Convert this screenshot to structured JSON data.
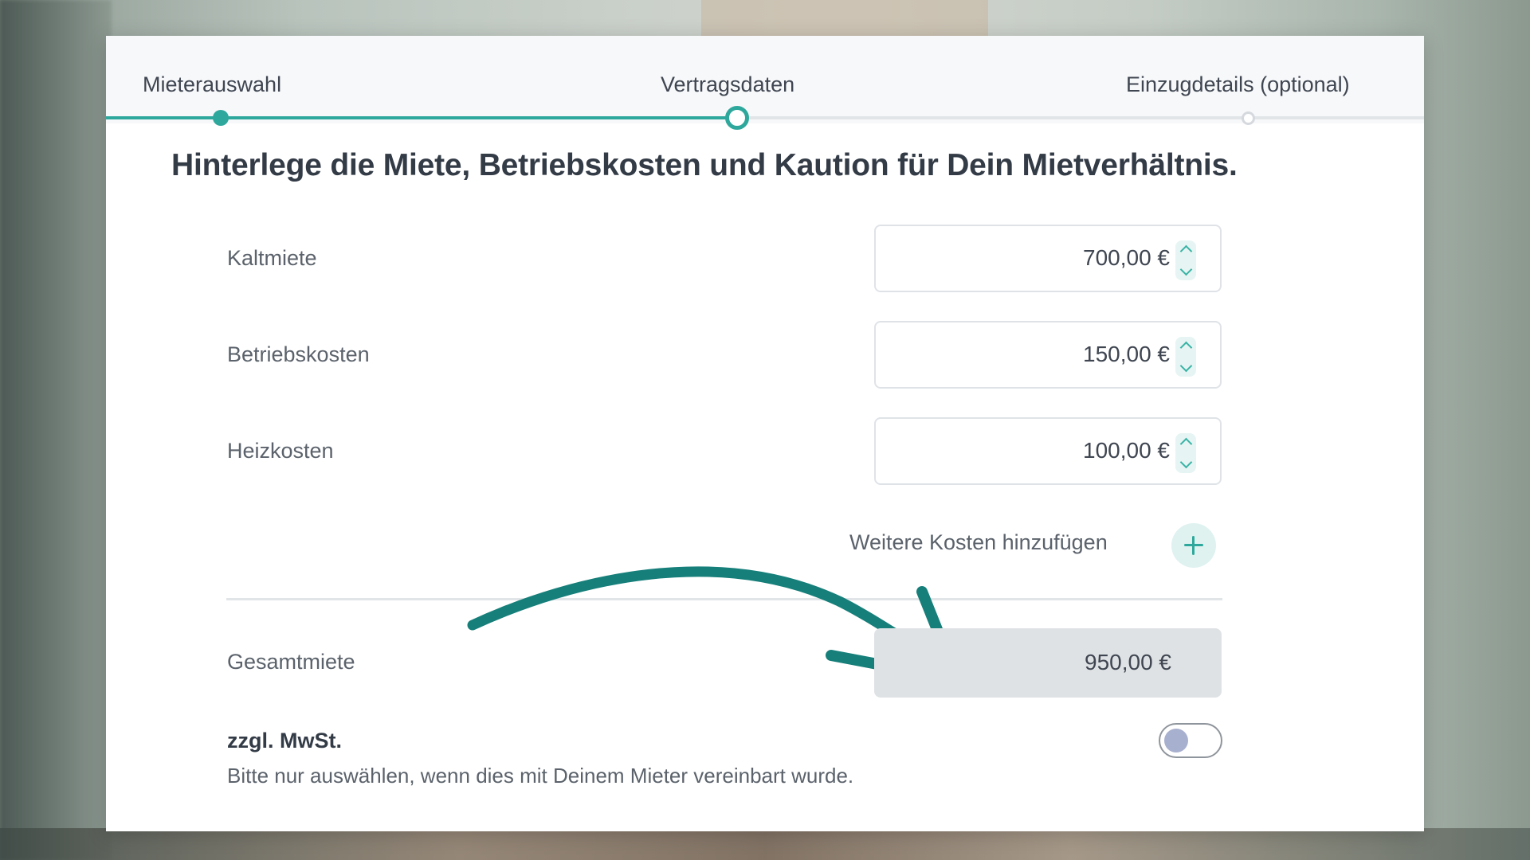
{
  "steps": [
    {
      "label": "Mieterauswahl",
      "state": "done"
    },
    {
      "label": "Vertragsdaten",
      "state": "active"
    },
    {
      "label": "Einzugdetails (optional)",
      "state": "upcoming"
    }
  ],
  "headline": "Hinterlege die Miete, Betriebskosten und Kaution für Dein Mietverhältnis.",
  "fields": [
    {
      "label": "Kaltmiete",
      "value": "700,00 €"
    },
    {
      "label": "Betriebskosten",
      "value": "150,00 €"
    },
    {
      "label": "Heizkosten",
      "value": "100,00 €"
    }
  ],
  "add_costs": {
    "label": "Weitere Kosten hinzufügen",
    "icon": "plus-icon"
  },
  "total": {
    "label": "Gesamtmiete",
    "value": "950,00 €"
  },
  "vat": {
    "title": "zzgl. MwSt.",
    "hint": "Bitte nur auswählen, wenn dies mit Deinem Mieter vereinbart wurde.",
    "enabled": false
  },
  "colors": {
    "accent": "#2ea89c",
    "arrow": "#167f7a",
    "total_bg": "#dfe2e5"
  }
}
